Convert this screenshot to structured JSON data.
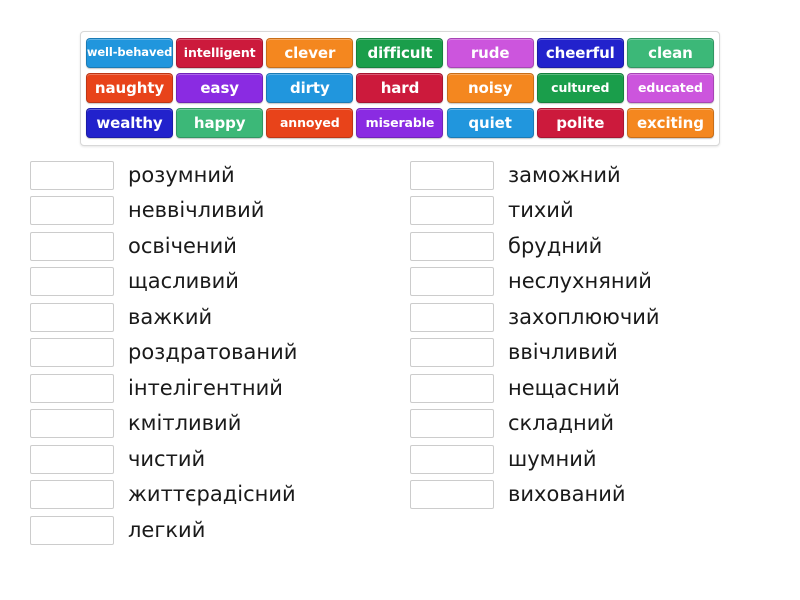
{
  "colors": {
    "sky_blue": "#2196dd",
    "crimson": "#cc1a3c",
    "orange": "#f4871f",
    "forest_green": "#1a9e4b",
    "orchid": "#cc55dd",
    "deep_blue": "#2222cc",
    "sea_green": "#3cb878",
    "orange_red": "#e8431a",
    "purple": "#8a2be2",
    "panel_border": "#d8d8d8",
    "box_border": "#cccccc",
    "text_dark": "#1a1a1a",
    "tile_text": "#ffffff"
  },
  "tile_bank": {
    "rows": [
      [
        {
          "label": "well-behaved",
          "color": "#2196dd",
          "size": "smaller"
        },
        {
          "label": "intelligent",
          "color": "#cc1a3c",
          "size": "small"
        },
        {
          "label": "clever",
          "color": "#f4871f",
          "size": "normal"
        },
        {
          "label": "difficult",
          "color": "#1a9e4b",
          "size": "normal"
        },
        {
          "label": "rude",
          "color": "#cc55dd",
          "size": "normal"
        },
        {
          "label": "cheerful",
          "color": "#2222cc",
          "size": "normal"
        },
        {
          "label": "clean",
          "color": "#3cb878",
          "size": "normal"
        }
      ],
      [
        {
          "label": "naughty",
          "color": "#e8431a",
          "size": "normal"
        },
        {
          "label": "easy",
          "color": "#8a2be2",
          "size": "normal"
        },
        {
          "label": "dirty",
          "color": "#2196dd",
          "size": "normal"
        },
        {
          "label": "hard",
          "color": "#cc1a3c",
          "size": "normal"
        },
        {
          "label": "noisy",
          "color": "#f4871f",
          "size": "normal"
        },
        {
          "label": "cultured",
          "color": "#1a9e4b",
          "size": "small"
        },
        {
          "label": "educated",
          "color": "#cc55dd",
          "size": "small"
        }
      ],
      [
        {
          "label": "wealthy",
          "color": "#2222cc",
          "size": "normal"
        },
        {
          "label": "happy",
          "color": "#3cb878",
          "size": "normal"
        },
        {
          "label": "annoyed",
          "color": "#e8431a",
          "size": "small"
        },
        {
          "label": "miserable",
          "color": "#8a2be2",
          "size": "small"
        },
        {
          "label": "quiet",
          "color": "#2196dd",
          "size": "normal"
        },
        {
          "label": "polite",
          "color": "#cc1a3c",
          "size": "normal"
        },
        {
          "label": "exciting",
          "color": "#f4871f",
          "size": "normal"
        }
      ]
    ]
  },
  "answer_rows": {
    "left": [
      {
        "word": "розумний",
        "answer": ""
      },
      {
        "word": "неввічливий",
        "answer": ""
      },
      {
        "word": "освічений",
        "answer": ""
      },
      {
        "word": "щасливий",
        "answer": ""
      },
      {
        "word": "важкий",
        "answer": ""
      },
      {
        "word": "роздратований",
        "answer": ""
      },
      {
        "word": "інтелігентний",
        "answer": ""
      },
      {
        "word": "кмітливий",
        "answer": ""
      },
      {
        "word": "чистий",
        "answer": ""
      },
      {
        "word": "життєрадісний",
        "answer": ""
      },
      {
        "word": "легкий",
        "answer": ""
      }
    ],
    "right": [
      {
        "word": "заможний",
        "answer": ""
      },
      {
        "word": "тихий",
        "answer": ""
      },
      {
        "word": "брудний",
        "answer": ""
      },
      {
        "word": "неслухняний",
        "answer": ""
      },
      {
        "word": "захоплюючий",
        "answer": ""
      },
      {
        "word": "ввічливий",
        "answer": ""
      },
      {
        "word": "нещасний",
        "answer": ""
      },
      {
        "word": "складний",
        "answer": ""
      },
      {
        "word": "шумний",
        "answer": ""
      },
      {
        "word": "вихований",
        "answer": ""
      }
    ]
  }
}
